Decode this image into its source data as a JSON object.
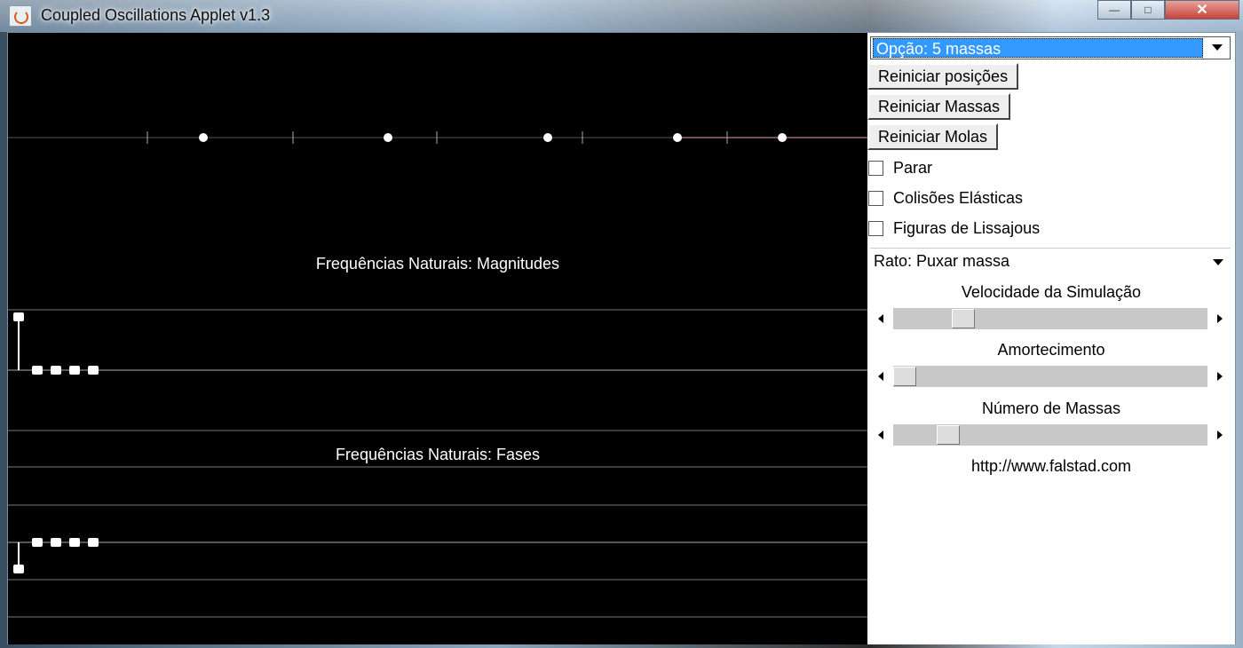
{
  "window": {
    "title": "Coupled Oscillations Applet v1.3",
    "icon": "java-cup-icon",
    "controls": {
      "minimize": "—",
      "maximize": "□",
      "close": "✕"
    }
  },
  "canvas": {
    "magnitudes_caption": "Frequências Naturais: Magnitudes",
    "phases_caption": "Frequências Naturais: Fases",
    "masses": 5,
    "magnitudes": [
      1,
      0,
      0,
      0,
      0
    ],
    "phases": [
      -1,
      0,
      0,
      0,
      0
    ],
    "colors": {
      "background": "#000000",
      "line": "#ffffff",
      "spring_active": "#e8a0a0",
      "rest_line": "#555555"
    }
  },
  "panel": {
    "option_select": "Opção: 5 massas",
    "reset_positions": "Reiniciar posições",
    "reset_masses": "Reiniciar Massas",
    "reset_springs": "Reiniciar Molas",
    "stop_checkbox": "Parar",
    "elastic_collisions_checkbox": "Colisões Elásticas",
    "lissajous_checkbox": "Figuras de Lissajous",
    "mouse_select": "Rato: Puxar massa",
    "speed_label": "Velocidade da Simulação",
    "speed_value": 0.2,
    "damping_label": "Amortecimento",
    "damping_value": 0.0,
    "mass_count_label": "Número de Massas",
    "mass_count_value": 0.15,
    "link": "http://www.falstad.com",
    "colors": {
      "selection": "#3399ff"
    }
  }
}
